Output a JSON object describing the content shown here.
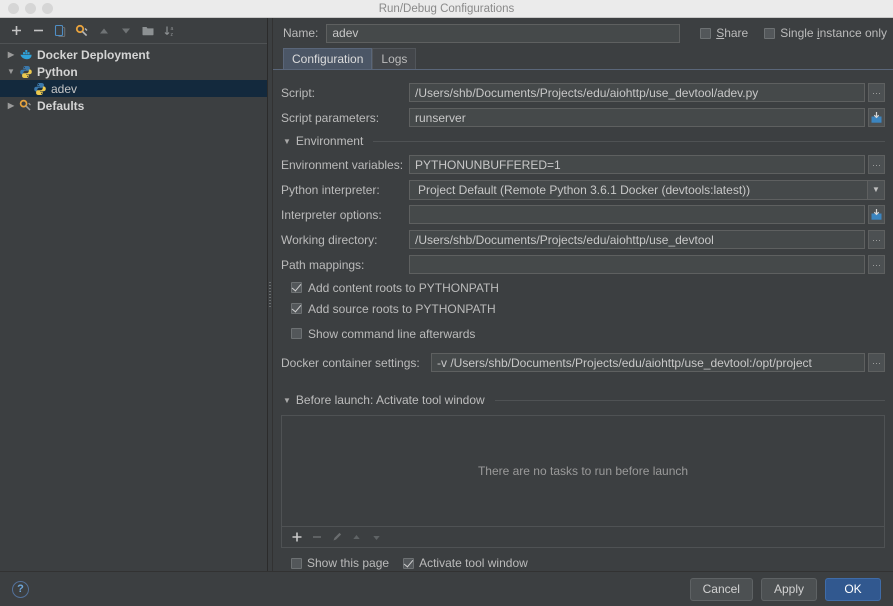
{
  "window": {
    "title": "Run/Debug Configurations",
    "traffic_lights": [
      "close-button",
      "minimize-button",
      "zoom-button"
    ]
  },
  "sidebar": {
    "toolbar": [
      {
        "name": "add-button",
        "glyph": "+"
      },
      {
        "name": "remove-button",
        "glyph": "−"
      },
      {
        "name": "copy-configuration-button",
        "glyph": "copy-icon"
      },
      {
        "name": "edit-defaults-button",
        "glyph": "wrench-icon"
      },
      {
        "name": "move-up-button",
        "glyph": "▲"
      },
      {
        "name": "move-down-button",
        "glyph": "▼"
      },
      {
        "name": "folder-button",
        "glyph": "folder-icon"
      },
      {
        "name": "sort-button",
        "glyph": "sort-az-icon"
      }
    ],
    "tree": [
      {
        "label": "Docker Deployment",
        "icon": "docker-whale-icon",
        "expanded": false,
        "depth": 0,
        "selected": false,
        "bold": true
      },
      {
        "label": "Python",
        "icon": "python-icon",
        "expanded": true,
        "depth": 0,
        "selected": false,
        "bold": true
      },
      {
        "label": "adev",
        "icon": "python-icon",
        "expanded": null,
        "depth": 1,
        "selected": true,
        "bold": false
      },
      {
        "label": "Defaults",
        "icon": "wrench-icon",
        "expanded": false,
        "depth": 0,
        "selected": false,
        "bold": true
      }
    ]
  },
  "header": {
    "name_label": "Name:",
    "name_value": "adev",
    "share_label": "Share",
    "share_checked": false,
    "single_instance_label": "Single instance only",
    "single_instance_checked": false
  },
  "tabs": [
    {
      "label": "Configuration",
      "active": true
    },
    {
      "label": "Logs",
      "active": false
    }
  ],
  "form": {
    "script": {
      "label": "Script:",
      "value": "/Users/shb/Documents/Projects/edu/aiohttp/use_devtool/adev.py",
      "button": "browse-ellipsis"
    },
    "script_parameters": {
      "label": "Script parameters:",
      "value": "runserver",
      "button": "expand-insert"
    },
    "environment_section": {
      "label": "Environment",
      "expanded": true
    },
    "environment_variables": {
      "label": "Environment variables:",
      "value": "PYTHONUNBUFFERED=1",
      "button": "browse-ellipsis"
    },
    "python_interpreter": {
      "label": "Python interpreter:",
      "value": "Project Default (Remote Python 3.6.1 Docker (devtools:latest))"
    },
    "interpreter_options": {
      "label": "Interpreter options:",
      "value": "",
      "button": "expand-insert"
    },
    "working_directory": {
      "label": "Working directory:",
      "value": "/Users/shb/Documents/Projects/edu/aiohttp/use_devtool",
      "button": "browse-ellipsis"
    },
    "path_mappings": {
      "label": "Path mappings:",
      "value": "",
      "button": "browse-ellipsis"
    },
    "add_content_roots": {
      "label": "Add content roots to PYTHONPATH",
      "checked": true
    },
    "add_source_roots": {
      "label": "Add source roots to PYTHONPATH",
      "checked": true
    },
    "show_command_line": {
      "label": "Show command line afterwards",
      "checked": false
    },
    "docker_container_settings": {
      "label": "Docker container settings:",
      "value": "-v /Users/shb/Documents/Projects/edu/aiohttp/use_devtool:/opt/project",
      "button": "browse-ellipsis"
    }
  },
  "before_launch": {
    "section_label": "Before launch: Activate tool window",
    "expanded": true,
    "empty_text": "There are no tasks to run before launch",
    "toolbar": [
      {
        "name": "add-task-button",
        "glyph": "+",
        "enabled": true
      },
      {
        "name": "remove-task-button",
        "glyph": "−",
        "enabled": false
      },
      {
        "name": "edit-task-button",
        "glyph": "pencil-icon",
        "enabled": false
      },
      {
        "name": "move-task-up-button",
        "glyph": "▲",
        "enabled": false
      },
      {
        "name": "move-task-down-button",
        "glyph": "▼",
        "enabled": false
      }
    ],
    "show_this_page": {
      "label": "Show this page",
      "checked": false
    },
    "activate_tool_window": {
      "label": "Activate tool window",
      "checked": true
    }
  },
  "footer": {
    "help_glyph": "?",
    "cancel_label": "Cancel",
    "apply_label": "Apply",
    "ok_label": "OK"
  },
  "colors": {
    "background": "#3c3f41",
    "field_background": "#45494a",
    "selection": "#13293d",
    "tab_active": "#4b5666",
    "primary_button": "#31588f",
    "help_accent": "#6fa8dc",
    "titlebar": "#ebebeb"
  }
}
